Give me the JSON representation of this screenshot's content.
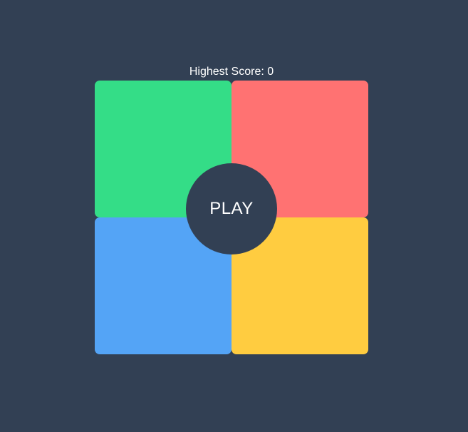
{
  "colors": {
    "background": "#324054",
    "green": "#34dd87",
    "red": "#ff7272",
    "blue": "#54a4f6",
    "yellow": "#ffcc40",
    "play_button": "#324054",
    "text": "#ffffff"
  },
  "score": {
    "label": "Highest Score: 0"
  },
  "play_button": {
    "label": "PLAY"
  }
}
